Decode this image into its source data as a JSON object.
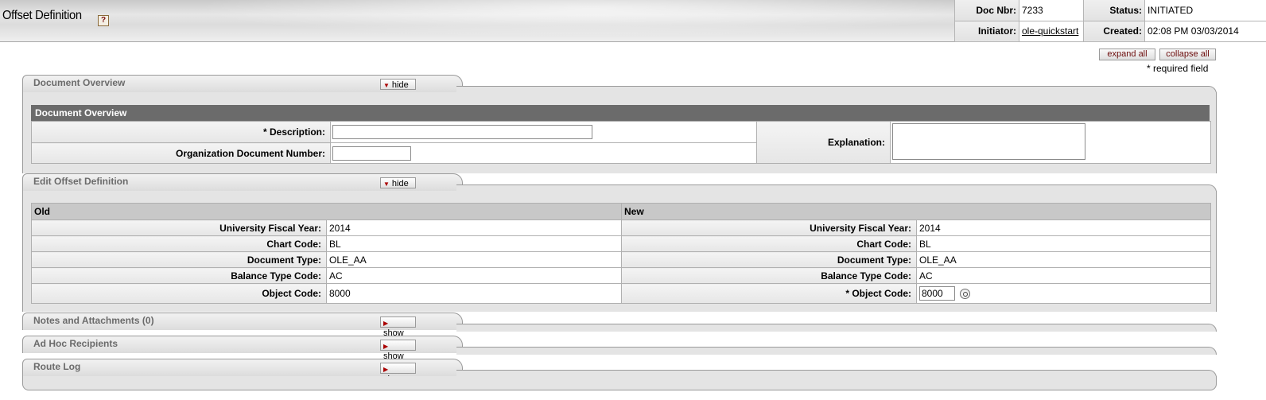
{
  "header": {
    "title": "Offset Definition",
    "help_icon": "?",
    "doc_nbr_label": "Doc Nbr:",
    "doc_nbr": "7233",
    "status_label": "Status:",
    "status": "INITIATED",
    "initiator_label": "Initiator:",
    "initiator": "ole-quickstart",
    "created_label": "Created:",
    "created": "02:08 PM 03/03/2014"
  },
  "controls": {
    "expand_all": "expand all",
    "collapse_all": "collapse all",
    "required_note": "* required field"
  },
  "tabs": {
    "doc_overview": {
      "label": "Document Overview",
      "toggle": "hide"
    },
    "edit_offset": {
      "label": "Edit Offset Definition",
      "toggle": "hide"
    },
    "notes": {
      "label": "Notes and Attachments (0)",
      "toggle": "show"
    },
    "adhoc": {
      "label": "Ad Hoc Recipients",
      "toggle": "show"
    },
    "route_log": {
      "label": "Route Log",
      "toggle": "show"
    }
  },
  "doc_overview": {
    "section_header": "Document Overview",
    "description_label": "* Description:",
    "description_value": "",
    "org_doc_label": "Organization Document Number:",
    "org_doc_value": "",
    "explanation_label": "Explanation:",
    "explanation_value": ""
  },
  "edit_offset": {
    "old_header": "Old",
    "new_header": "New",
    "fiscal_year_label": "University Fiscal Year:",
    "chart_code_label": "Chart Code:",
    "doc_type_label": "Document Type:",
    "balance_type_label": "Balance Type Code:",
    "object_code_label": "Object Code:",
    "object_code_new_label": "* Object Code:",
    "old": {
      "fiscal_year": "2014",
      "chart_code": "BL",
      "doc_type": "OLE_AA",
      "balance_type": "AC",
      "object_code": "8000"
    },
    "new": {
      "fiscal_year": "2014",
      "chart_code": "BL",
      "doc_type": "OLE_AA",
      "balance_type": "AC",
      "object_code": "8000"
    }
  },
  "icons": {
    "toggle_hide": "triangle-down-icon",
    "toggle_show": "triangle-right-icon",
    "lookup": "magnifier-icon",
    "help": "help-icon"
  }
}
